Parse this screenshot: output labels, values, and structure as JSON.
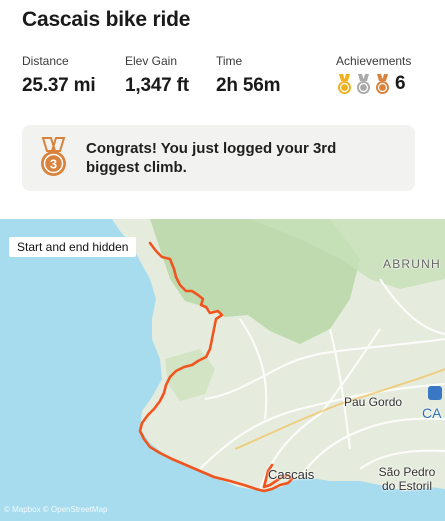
{
  "title": "Cascais bike ride",
  "stats": {
    "distance": {
      "label": "Distance",
      "value": "25.37 mi"
    },
    "elevation": {
      "label": "Elev Gain",
      "value": "1,347 ft"
    },
    "time": {
      "label": "Time",
      "value": "2h 56m"
    },
    "achievements": {
      "label": "Achievements",
      "count": "6",
      "medals": [
        "gold-medal-icon",
        "silver-medal-icon",
        "bronze-medal-icon"
      ]
    }
  },
  "congrats": {
    "text": "Congrats! You just logged your 3rd biggest climb.",
    "medal_number": "3",
    "medal_icon": "bronze-medal-icon"
  },
  "map": {
    "start_end_label": "Start and end hidden",
    "places": {
      "abrunh": "ABRUNH",
      "pau_gordo": "Pau Gordo",
      "cascais": "Cascais",
      "sao_pedro": "São Pedro do Estoril",
      "ca": "CA"
    },
    "attribution": "© Mapbox © OpenStreetMap",
    "colors": {
      "route": "#f0551f",
      "sea": "#a7dcef",
      "land": "#e6ecdd",
      "hills": "#b9d8a8"
    }
  },
  "colors": {
    "gold": "#f2b01e",
    "silver": "#a9a9a9",
    "bronze": "#d9823b",
    "card_bg": "#f2f2f0"
  }
}
